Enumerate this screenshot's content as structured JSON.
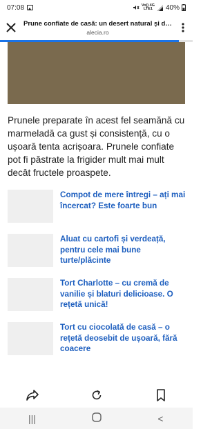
{
  "status_bar": {
    "time": "07:08",
    "network_top": "Vo)) 4G",
    "network_bottom": "LTE1",
    "battery": "40%"
  },
  "header": {
    "title": "Prune confiate de casă: un desert natural și del...",
    "url": "alecia.ro",
    "close_icon": "close-icon",
    "menu_icon": "more-vert-icon"
  },
  "progress": {
    "fraction": 0.93
  },
  "article": {
    "paragraph": "Prunele preparate în acest fel seamănă cu marmeladă ca gust și consistență, cu o ușoară tenta acrișoara. Prunele confiate pot fi păstrate la frigider mult mai mult decât fructele proaspete."
  },
  "related": [
    {
      "title": "Compot de mere întregi – ați mai încercat? Este foarte bun"
    },
    {
      "title": "Aluat cu cartofi și verdeață, pentru cele mai bune turte/plăcinte"
    },
    {
      "title": "Tort Charlotte – cu cremă de vanilie și blaturi delicioase. O rețetă unică!"
    },
    {
      "title": "Tort cu ciocolată de casă – o rețetă deosebit de ușoară, fără coacere"
    }
  ],
  "toolbar": {
    "share_icon": "share-icon",
    "refresh_icon": "refresh-icon",
    "bookmark_icon": "bookmark-icon"
  },
  "nav": {
    "recents_glyph": "|||",
    "back_glyph": "<"
  },
  "colors": {
    "link": "#1e5fbf",
    "progress": "#1a73e8",
    "hero": "#7a6a4e"
  }
}
